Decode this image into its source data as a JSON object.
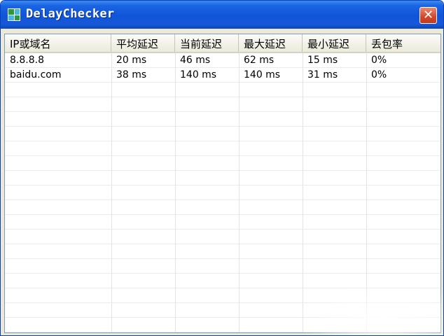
{
  "window": {
    "title": "DelayChecker",
    "icon": "app-grid-icon",
    "close_glyph": "✕"
  },
  "table": {
    "headers": [
      "IP或域名",
      "平均延迟",
      "当前延迟",
      "最大延迟",
      "最小延迟",
      "丢包率"
    ],
    "rows": [
      [
        "8.8.8.8",
        "20 ms",
        "46 ms",
        "62 ms",
        "15 ms",
        "0%"
      ],
      [
        "baidu.com",
        "38 ms",
        "140 ms",
        "140 ms",
        "31 ms",
        "0%"
      ]
    ]
  },
  "colors": {
    "title_bar": "#0f55d9",
    "close_button": "#d2472a",
    "window_face": "#ece9d8"
  }
}
